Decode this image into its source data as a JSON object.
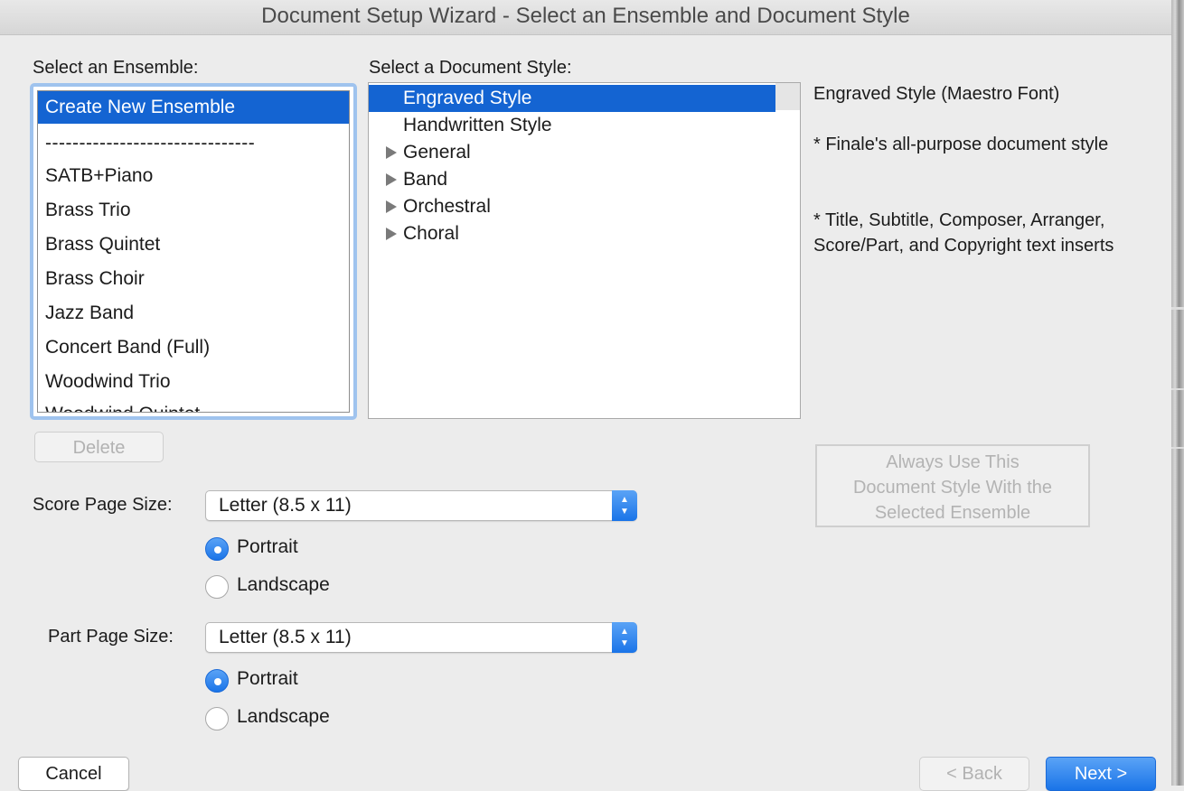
{
  "window": {
    "title": "Document Setup Wizard - Select an Ensemble and Document Style"
  },
  "ensemble": {
    "label": "Select an Ensemble:",
    "items": [
      {
        "label": "Create New Ensemble",
        "selected": true
      },
      {
        "label": "-------------------------------"
      },
      {
        "label": "SATB+Piano"
      },
      {
        "label": "Brass Trio"
      },
      {
        "label": "Brass Quintet"
      },
      {
        "label": "Brass Choir"
      },
      {
        "label": "Jazz Band"
      },
      {
        "label": "Concert Band (Full)"
      },
      {
        "label": "Woodwind Trio"
      },
      {
        "label": "Woodwind Quintet"
      }
    ],
    "delete_label": "Delete"
  },
  "document_style": {
    "label": "Select a Document Style:",
    "items": [
      {
        "label": "Engraved Style",
        "selected": true,
        "expandable": false
      },
      {
        "label": "Handwritten Style",
        "expandable": false
      },
      {
        "label": "General",
        "expandable": true
      },
      {
        "label": "Band",
        "expandable": true
      },
      {
        "label": "Orchestral",
        "expandable": true
      },
      {
        "label": "Choral",
        "expandable": true
      }
    ]
  },
  "description": {
    "title": "Engraved Style (Maestro Font)",
    "line1": "* Finale's all-purpose document style",
    "line2": "* Title, Subtitle, Composer, Arranger, Score/Part, and Copyright text inserts"
  },
  "always_use_button": {
    "line1": "Always Use This",
    "line2": "Document Style With the",
    "line3": "Selected Ensemble"
  },
  "score_page": {
    "label": "Score Page Size:",
    "value": "Letter (8.5 x 11)",
    "portrait_label": "Portrait",
    "landscape_label": "Landscape",
    "orientation": "Portrait"
  },
  "part_page": {
    "label": "Part Page Size:",
    "value": "Letter (8.5 x 11)",
    "portrait_label": "Portrait",
    "landscape_label": "Landscape",
    "orientation": "Portrait"
  },
  "footer": {
    "cancel_label": "Cancel",
    "back_label": "< Back",
    "next_label": "Next >"
  },
  "colors": {
    "selection": "#1464d2",
    "focus_ring": "#9fc3ee",
    "accent": "#1a74e8"
  }
}
